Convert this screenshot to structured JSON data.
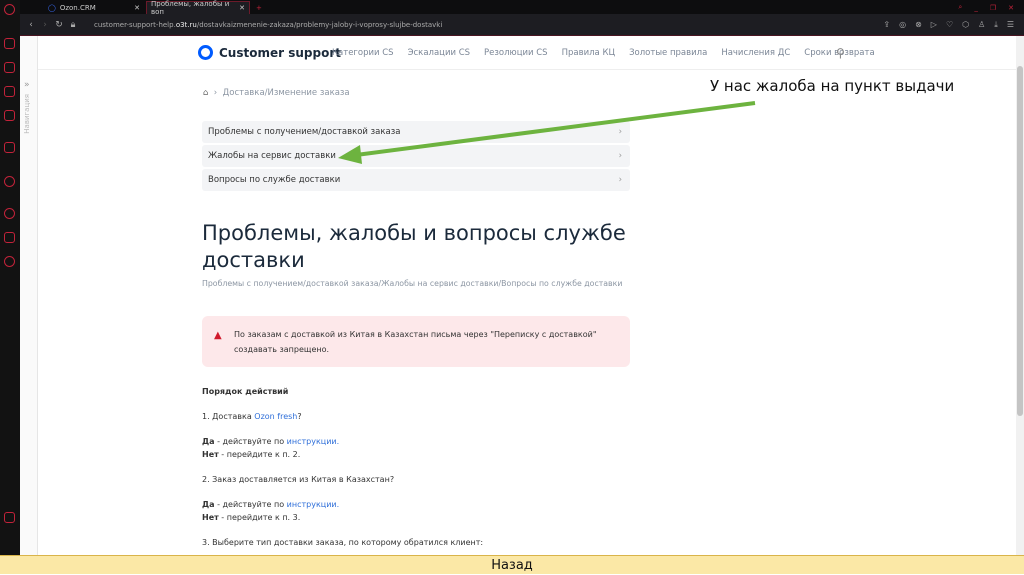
{
  "browser": {
    "tabs": [
      {
        "label": "Ozon.CRM"
      },
      {
        "label": "Проблемы, жалобы и воп"
      }
    ],
    "url_prefix": "customer-support-help.",
    "url_domain": "o3t.ru",
    "url_path": "/dostavkaizmenenie-zakaza/problemy-jaloby-i-voprosy-slujbe-dostavki"
  },
  "header": {
    "logo": "Customer support",
    "menu": [
      "Категории CS",
      "Эскалации CS",
      "Резолюции CS",
      "Правила КЦ",
      "Золотые правила",
      "Начисления ДС",
      "Сроки возврата"
    ]
  },
  "sidenav": {
    "label": "Навигация"
  },
  "breadcrumb": "Доставка/Изменение заказа",
  "cards": [
    "Проблемы с получением/доставкой заказа",
    "Жалобы на сервис доставки",
    "Вопросы по службе доставки"
  ],
  "title": "Проблемы, жалобы и вопросы службе доставки",
  "subtitle": "Проблемы с получением/доставкой заказа/Жалобы на сервис доставки/Вопросы по службе доставки",
  "alert": "По заказам с доставкой из Китая в Казахстан письма через \"Переписку с доставкой\" создавать запрещено.",
  "content": {
    "heading": "Порядок действий",
    "q1": "1. Доставка ",
    "q1_link": "Ozon fresh",
    "q1_end": "?",
    "yes": "Да",
    "yes_text": " - действуйте по ",
    "link": "инструкции.",
    "no": "Нет",
    "no1_text": " - перейдите к п. 2.",
    "q2": "2. Заказ доставляется из Китая в Казахстан?",
    "no2_text": " - перейдите к п. 3.",
    "q3": "3. Выберите тип доставки заказа, по которому обратился клиент:"
  },
  "annotation": "У нас жалоба на пункт выдачи",
  "back_button": "Назад",
  "colors": {
    "arrow": "#6db33f",
    "accent": "#005bff"
  }
}
